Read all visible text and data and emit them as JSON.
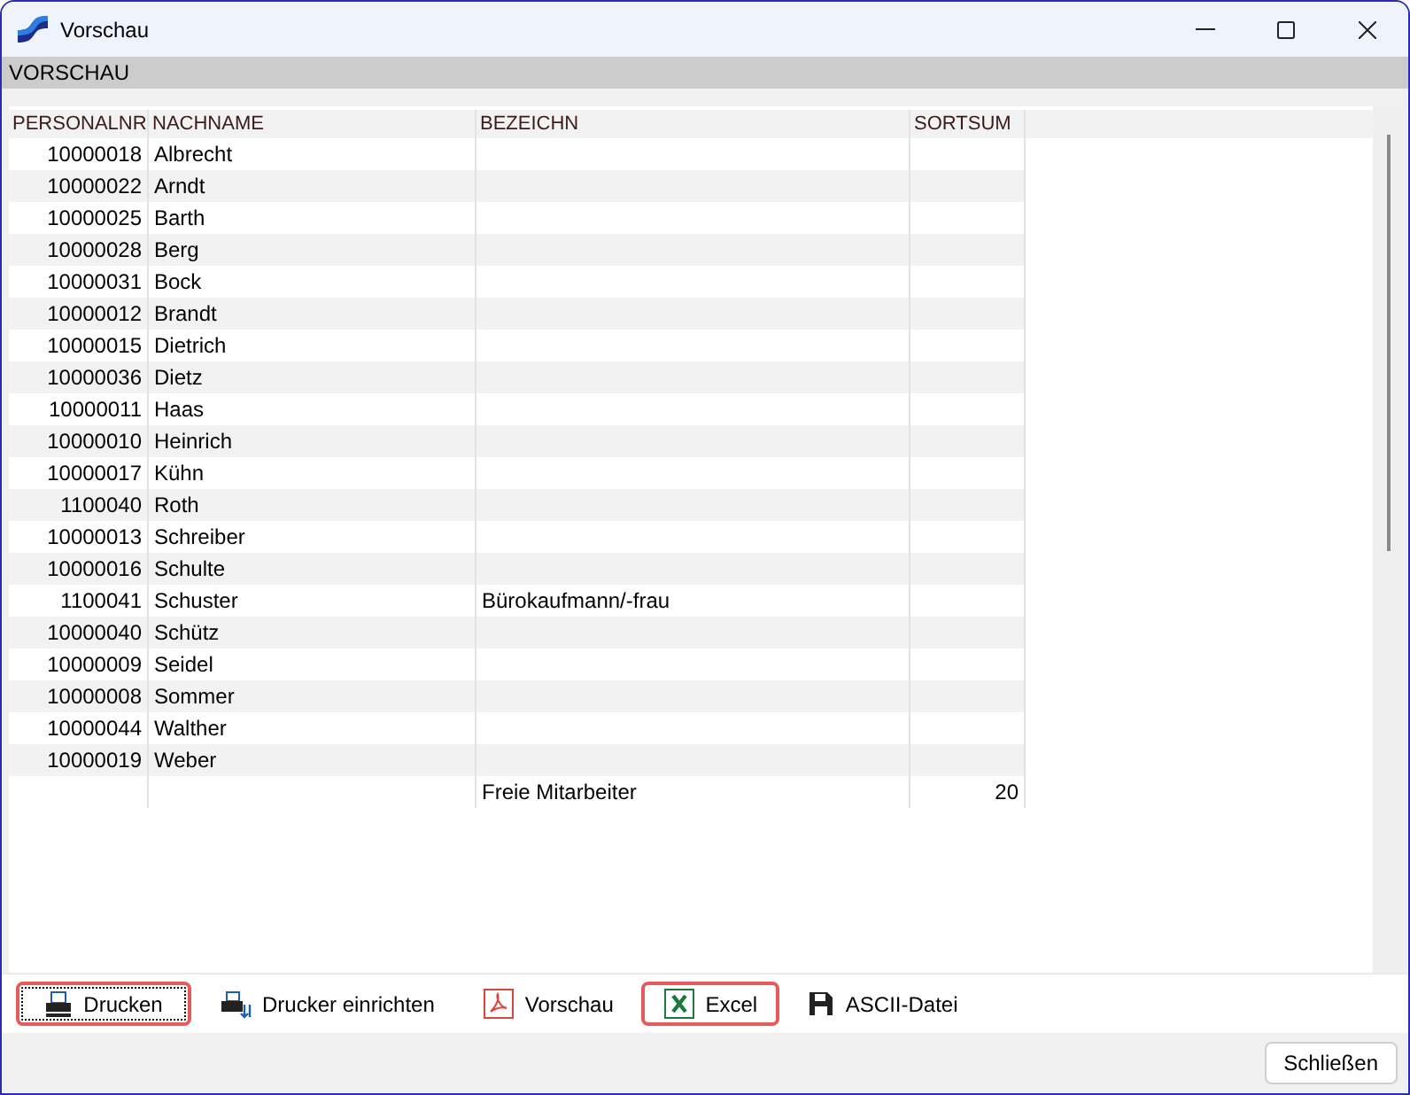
{
  "window": {
    "title": "Vorschau"
  },
  "section_title": "VORSCHAU",
  "table": {
    "columns": [
      "PERSONALNR",
      "NACHNAME",
      "BEZEICHN",
      "SORTSUM"
    ],
    "rows": [
      [
        "10000018",
        "Albrecht",
        "",
        ""
      ],
      [
        "10000022",
        "Arndt",
        "",
        ""
      ],
      [
        "10000025",
        "Barth",
        "",
        ""
      ],
      [
        "10000028",
        "Berg",
        "",
        ""
      ],
      [
        "10000031",
        "Bock",
        "",
        ""
      ],
      [
        "10000012",
        "Brandt",
        "",
        ""
      ],
      [
        "10000015",
        "Dietrich",
        "",
        ""
      ],
      [
        "10000036",
        "Dietz",
        "",
        ""
      ],
      [
        "10000011",
        "Haas",
        "",
        ""
      ],
      [
        "10000010",
        "Heinrich",
        "",
        ""
      ],
      [
        "10000017",
        "Kühn",
        "",
        ""
      ],
      [
        "1100040",
        "Roth",
        "",
        ""
      ],
      [
        "10000013",
        "Schreiber",
        "",
        ""
      ],
      [
        "10000016",
        "Schulte",
        "",
        ""
      ],
      [
        "1100041",
        "Schuster",
        "Bürokaufmann/-frau",
        ""
      ],
      [
        "10000040",
        "Schütz",
        "",
        ""
      ],
      [
        "10000009",
        "Seidel",
        "",
        ""
      ],
      [
        "10000008",
        "Sommer",
        "",
        ""
      ],
      [
        "10000044",
        "Walther",
        "",
        ""
      ],
      [
        "10000019",
        "Weber",
        "",
        ""
      ],
      [
        "",
        "",
        "Freie Mitarbeiter",
        "20"
      ]
    ]
  },
  "toolbar": [
    {
      "kind": "print",
      "label": "Drucken",
      "highlighted": true,
      "focused": true
    },
    {
      "kind": "printer-setup",
      "label": "Drucker einrichten",
      "highlighted": false,
      "focused": false
    },
    {
      "kind": "pdf",
      "label": "Vorschau",
      "highlighted": false,
      "focused": false
    },
    {
      "kind": "excel",
      "label": "Excel",
      "highlighted": true,
      "focused": false
    },
    {
      "kind": "save",
      "label": "ASCII-Datei",
      "highlighted": false,
      "focused": false
    }
  ],
  "close_button": "Schließen"
}
